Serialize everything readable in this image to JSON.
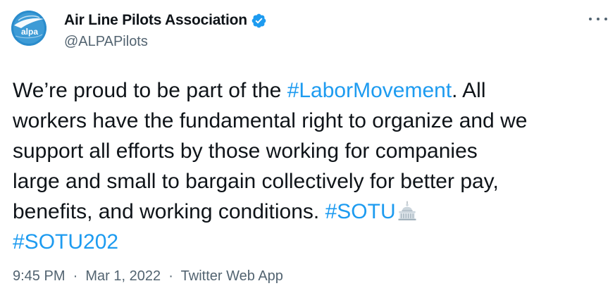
{
  "author": {
    "display_name": "Air Line Pilots Association",
    "handle": "@ALPAPilots",
    "avatar_text": "alpa",
    "verified_icon": "verified-badge-icon"
  },
  "more_icon": "more-options-icon",
  "tweet": {
    "lines": [
      [
        {
          "t": "We’re proud to be part of the "
        },
        {
          "t": "#LaborMovement",
          "tag": true
        },
        {
          "t": ". All"
        }
      ],
      [
        {
          "t": "workers have the fundamental right to organize and we"
        }
      ],
      [
        {
          "t": "support all efforts by those working for companies"
        }
      ],
      [
        {
          "t": "large and small to bargain collectively for better pay,"
        }
      ],
      [
        {
          "t": "benefits, and working conditions. "
        },
        {
          "t": "#SOTU",
          "tag": true
        },
        {
          "emoji": "capitol-building-icon"
        }
      ],
      [
        {
          "t": "#SOTU202",
          "tag": true
        }
      ]
    ]
  },
  "meta": {
    "time": "9:45 PM",
    "separator": "·",
    "date": "Mar 1, 2022",
    "source": "Twitter Web App"
  },
  "colors": {
    "text": "#0f1419",
    "secondary": "#536471",
    "link": "#1d9bf0",
    "avatar_bg": "#2a8ccc"
  }
}
